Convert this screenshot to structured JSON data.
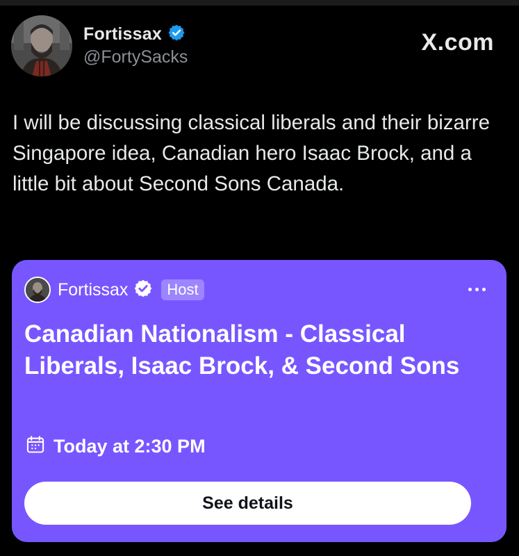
{
  "author": {
    "display_name": "Fortissax",
    "handle": "@FortySacks",
    "verified": true
  },
  "brand": {
    "logo_text": "X.com"
  },
  "tweet": {
    "text": "I will be discussing classical liberals and their bizarre Singapore idea, Canadian hero Isaac Brock, and a little bit about Second Sons Canada."
  },
  "space_card": {
    "host_name": "Fortissax",
    "host_badge": "Host",
    "title": "Canadian Nationalism - Classical Liberals, Isaac Brock, & Second Sons",
    "schedule": "Today at 2:30 PM",
    "button_label": "See details",
    "more_icon": "more-dots-icon",
    "calendar_icon": "calendar-icon"
  },
  "colors": {
    "background": "#000000",
    "card": "#7856ff",
    "verified_blue": "#1d9bf0",
    "handle_gray": "#8b9097"
  }
}
